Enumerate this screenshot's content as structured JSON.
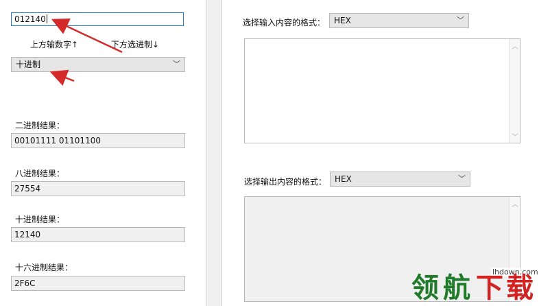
{
  "left": {
    "number_input_value": "012140",
    "hint_up": "上方输数字↑",
    "hint_down": "下方选进制↓",
    "radix_select_value": "十进制",
    "results": [
      {
        "label": "二进制结果：",
        "value": "00101111 01101100"
      },
      {
        "label": "八进制结果：",
        "value": "27554"
      },
      {
        "label": "十进制结果：",
        "value": "12140"
      },
      {
        "label": "十六进制结果：",
        "value": "2F6C"
      }
    ]
  },
  "right": {
    "input_format_label": "选择输入内容的格式：",
    "input_format_value": "HEX",
    "output_format_label": "选择输出内容的格式：",
    "output_format_value": "HEX"
  },
  "watermark": {
    "url": "lhdown.com",
    "chars": [
      "领",
      "航",
      "下",
      "载"
    ]
  },
  "colors": {
    "arrow": "#d42a2a",
    "focus_border": "#2b79d6",
    "watermark_green": "#1f7a2a",
    "watermark_red": "#d32222"
  }
}
